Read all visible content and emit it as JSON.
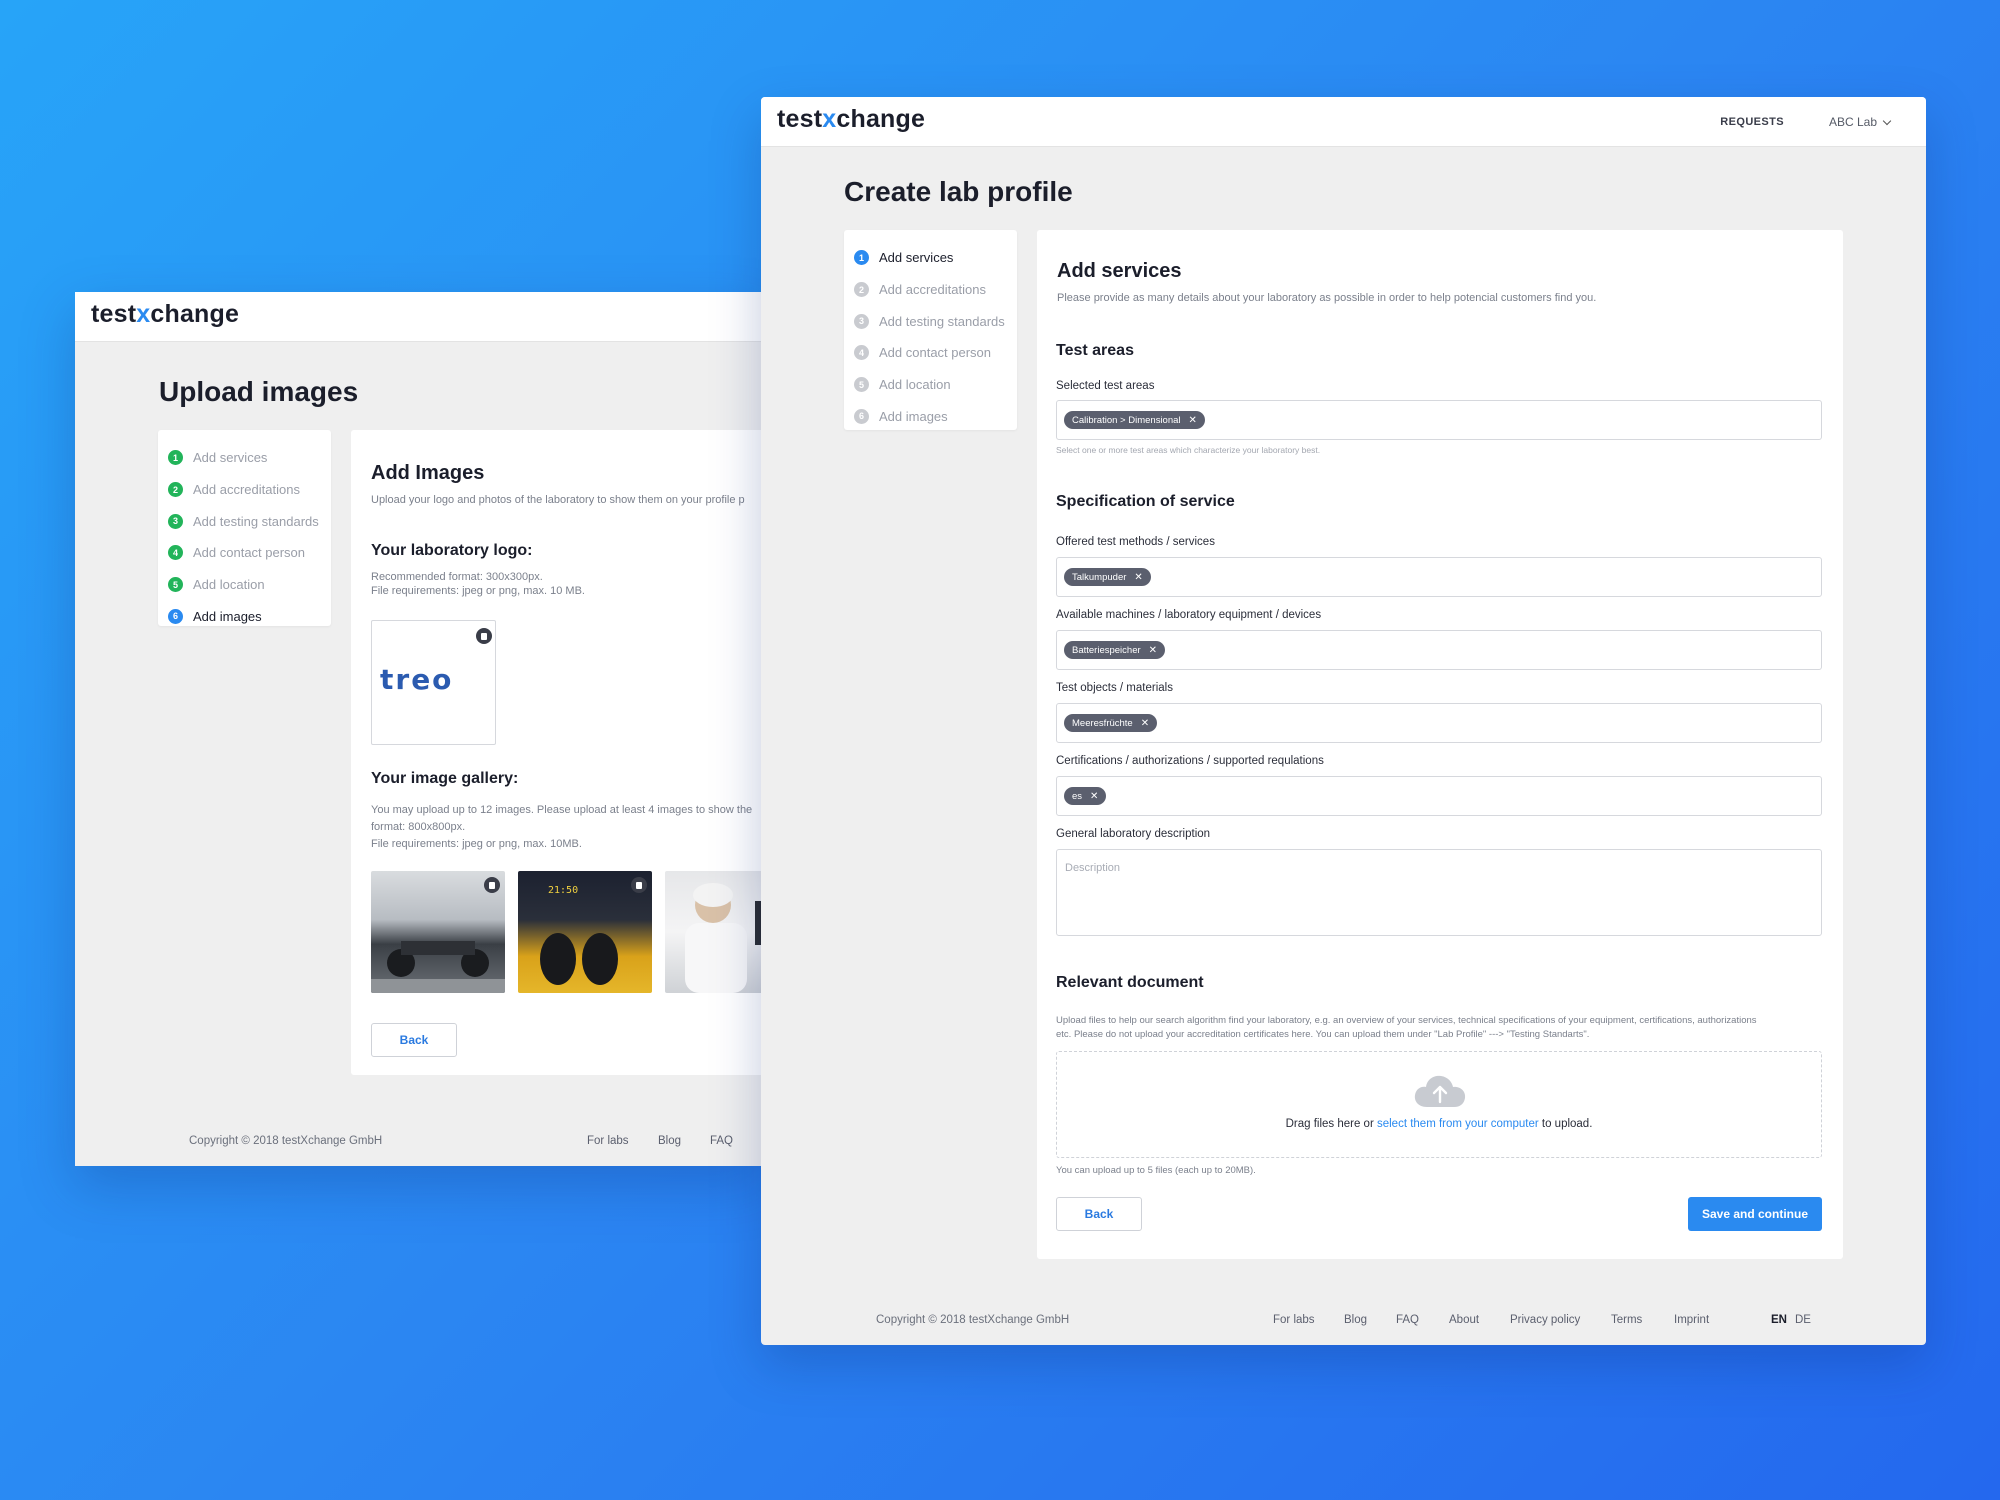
{
  "brand": {
    "logo_left": "test",
    "logo_x": "x",
    "logo_right": "change"
  },
  "back_window": {
    "page_title": "Upload images",
    "steps": [
      {
        "n": "1",
        "label": "Add services"
      },
      {
        "n": "2",
        "label": "Add accreditations"
      },
      {
        "n": "3",
        "label": "Add testing standards"
      },
      {
        "n": "4",
        "label": "Add contact person"
      },
      {
        "n": "5",
        "label": "Add location"
      },
      {
        "n": "6",
        "label": "Add images"
      }
    ],
    "heading": "Add Images",
    "subheading": "Upload your logo and photos of the laboratory to show them on your profile p",
    "logo_section": {
      "title": "Your laboratory logo:",
      "rec": "Recommended format: 300x300px.",
      "req": "File requirements: jpeg or png, max. 10 MB.",
      "logo_text": "treo"
    },
    "gallery": {
      "title": "Your image gallery:",
      "line1": "You may upload up to 12 images. Please upload at least 4 images to show the",
      "line2": "format: 800x800px.",
      "line3": "File requirements: jpeg or png, max. 10MB."
    },
    "back_button": "Back",
    "footer": {
      "copyright": "Copyright © 2018 testXchange GmbH",
      "links": [
        "For labs",
        "Blog",
        "FAQ"
      ]
    }
  },
  "front_window": {
    "nav": {
      "requests": "REQUESTS",
      "account": "ABC Lab"
    },
    "page_title": "Create lab profile",
    "steps": [
      {
        "n": "1",
        "label": "Add services"
      },
      {
        "n": "2",
        "label": "Add accreditations"
      },
      {
        "n": "3",
        "label": "Add testing standards"
      },
      {
        "n": "4",
        "label": "Add contact person"
      },
      {
        "n": "5",
        "label": "Add location"
      },
      {
        "n": "6",
        "label": "Add images"
      }
    ],
    "heading": "Add services",
    "subheading": "Please provide as many details about your laboratory as possible in order to help potencial customers find you.",
    "test_areas": {
      "title": "Test areas",
      "label": "Selected test areas",
      "chip": "Calibration > Dimensional",
      "hint": "Select one or more test areas which characterize your laboratory best."
    },
    "spec": {
      "title": "Specification of service",
      "fields": [
        {
          "label": "Offered test methods / services",
          "chip": "Talkumpuder"
        },
        {
          "label": "Available machines / laboratory equipment / devices",
          "chip": "Batteriespeicher"
        },
        {
          "label": "Test objects / materials",
          "chip": "Meeresfrüchte"
        },
        {
          "label": "Certifications / authorizations / supported requlations",
          "chip": "es"
        }
      ],
      "description_label": "General laboratory description",
      "description_placeholder": "Description"
    },
    "document": {
      "title": "Relevant document",
      "text1": "Upload files to help our search algorithm find your laboratory, e.g. an overview of your services, technical specifications of your equipment, certifications, authorizations",
      "text2": "etc. Please do not upload your accreditation certificates here. You can upload them under \"Lab Profile\" ---> \"Testing Standarts\".",
      "drop_before": "Drag files here or ",
      "drop_link": "select them from your computer",
      "drop_after": " to upload.",
      "limit": "You can upload up to 5 files (each up to 20MB)."
    },
    "back_button": "Back",
    "save_button": "Save and continue",
    "footer": {
      "copyright": "Copyright © 2018 testXchange GmbH",
      "links": [
        "For labs",
        "Blog",
        "FAQ",
        "About",
        "Privacy policy",
        "Terms",
        "Imprint"
      ],
      "lang_en": "EN",
      "lang_de": "DE"
    }
  }
}
